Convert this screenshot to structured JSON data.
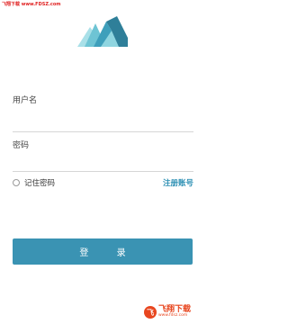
{
  "watermark_top": "飞翔下载 www.FDSZ.com",
  "form": {
    "username_label": "用户名",
    "username_value": "",
    "password_label": "密码",
    "password_value": "",
    "remember_label": "记住密码",
    "remember_checked": false,
    "register_label": "注册账号",
    "login_label": "登 录"
  },
  "watermark_bottom": {
    "title": "飞翔下载",
    "subtitle": "www.fdsz.com"
  },
  "colors": {
    "accent": "#3a93b3",
    "link": "#2b8fb3",
    "logo_light": "#7ccfdc",
    "logo_dark": "#2f7f99"
  }
}
